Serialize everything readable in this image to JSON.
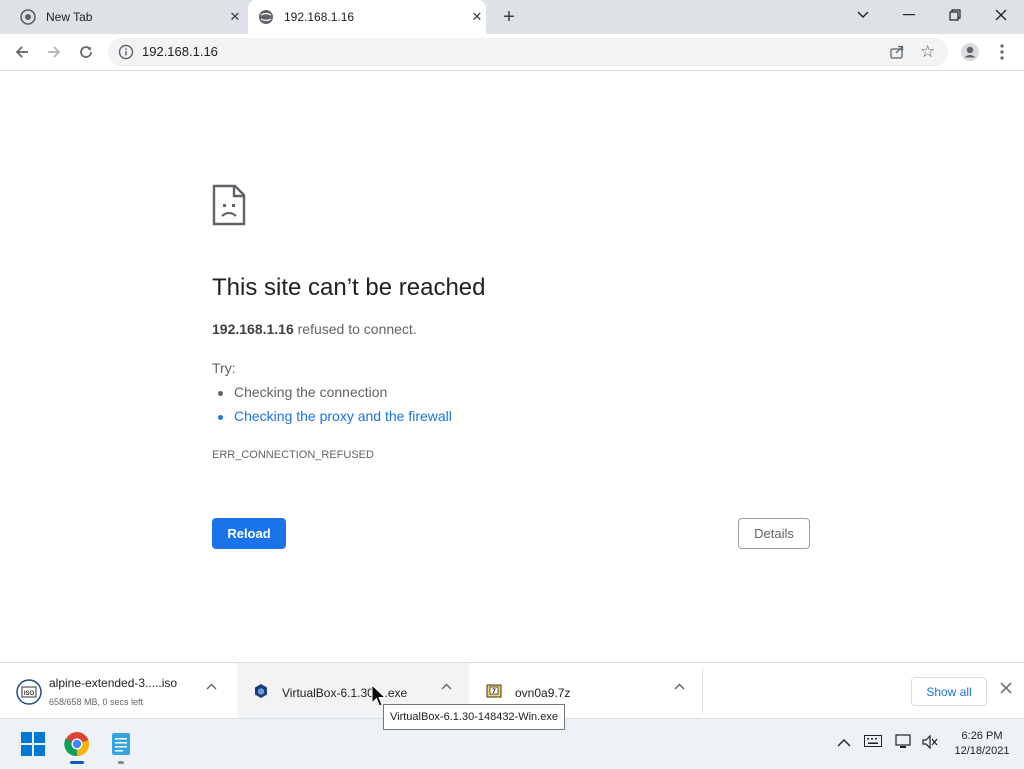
{
  "tabs": [
    {
      "title": "New Tab",
      "active": false
    },
    {
      "title": "192.168.1.16",
      "active": true
    }
  ],
  "toolbar": {
    "url": "192.168.1.16"
  },
  "error": {
    "heading": "This site can’t be reached",
    "host": "192.168.1.16",
    "summary_suffix": " refused to connect.",
    "try_label": "Try:",
    "suggestions": [
      "Checking the connection",
      "Checking the proxy and the firewall"
    ],
    "code": "ERR_CONNECTION_REFUSED",
    "reload_label": "Reload",
    "details_label": "Details"
  },
  "downloads": [
    {
      "name": "alpine-extended-3.....iso",
      "status": "658/658 MB, 0 secs left",
      "icon": "iso-file-icon"
    },
    {
      "name": "VirtualBox-6.1.30-...exe",
      "status": "",
      "icon": "virtualbox-icon"
    },
    {
      "name": "ovn0a9.7z",
      "status": "",
      "icon": "archive-icon"
    }
  ],
  "download_shelf": {
    "show_all_label": "Show all",
    "tooltip": "VirtualBox-6.1.30-148432-Win.exe"
  },
  "taskbar": {
    "time": "6:26 PM",
    "date": "12/18/2021"
  },
  "colors": {
    "accent": "#1a73e8",
    "tabstrip": "#dee1e6",
    "taskbar": "#eef2f7"
  }
}
